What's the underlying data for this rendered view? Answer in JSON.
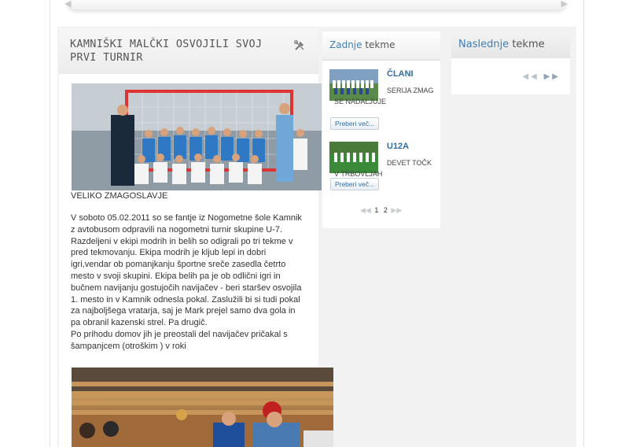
{
  "slider": {
    "prev_icon": "◀",
    "next_icon": "▶"
  },
  "article": {
    "title": "KAMNIŠKI MALČKI OSVOJILI SVOJ PRVI TURNIR",
    "caption": "VELIKO ZMAGOSLAVJE",
    "body": "V soboto 05.02.2011 so se fantje iz Nogometne šole Kamnik\nz avtobusom odpravili na nogometni turnir skupine U-7.\nRazdeljeni v ekipi modrih in belih so odigrali po tri tekme v\npred tekmovanju. Ekipa modrih je kljub lepi in dobri\nigri,vendar ob pomanjkanju športne sreče zasedla četrto\nmesto v svoji skupini. Ekipa belih pa je ob odlični igri in\nbučnem navijanju gostujočih navijačev - beri staršev osvojila\n1. mesto in v Kamnik odnesla pokal. Zaslužili bi si tudi pokal\nza najboljšega vratarja, saj je Mark prejel samo dva gola in\npa obranil kazenski strel. Pa drugič.\nPo prihodu domov  jih je preostali del navijačev pričakal s\nšampanjcem (otroškim ) v roki"
  },
  "last_matches": {
    "title_highlight": "Zadnje",
    "title_rest": "tekme",
    "items": [
      {
        "team": "ČLANI",
        "desc": "SERIJA ZMAG SE NADALJUJE",
        "button": "Preberi več..."
      },
      {
        "team": "U12A",
        "desc": "DEVET TOČK V TRBOVLJAH",
        "button": "Preberi več..."
      }
    ],
    "pager": {
      "prev": "◀◀",
      "pages": [
        "1",
        "2"
      ],
      "next": "▶▶"
    }
  },
  "next_matches": {
    "title_highlight": "Naslednje",
    "title_rest": "tekme",
    "prev": "◀◀",
    "next": "▶▶"
  },
  "colors": {
    "accent": "#3f7fb6",
    "link": "#2e6ea4",
    "band": "#f2f2f2"
  }
}
